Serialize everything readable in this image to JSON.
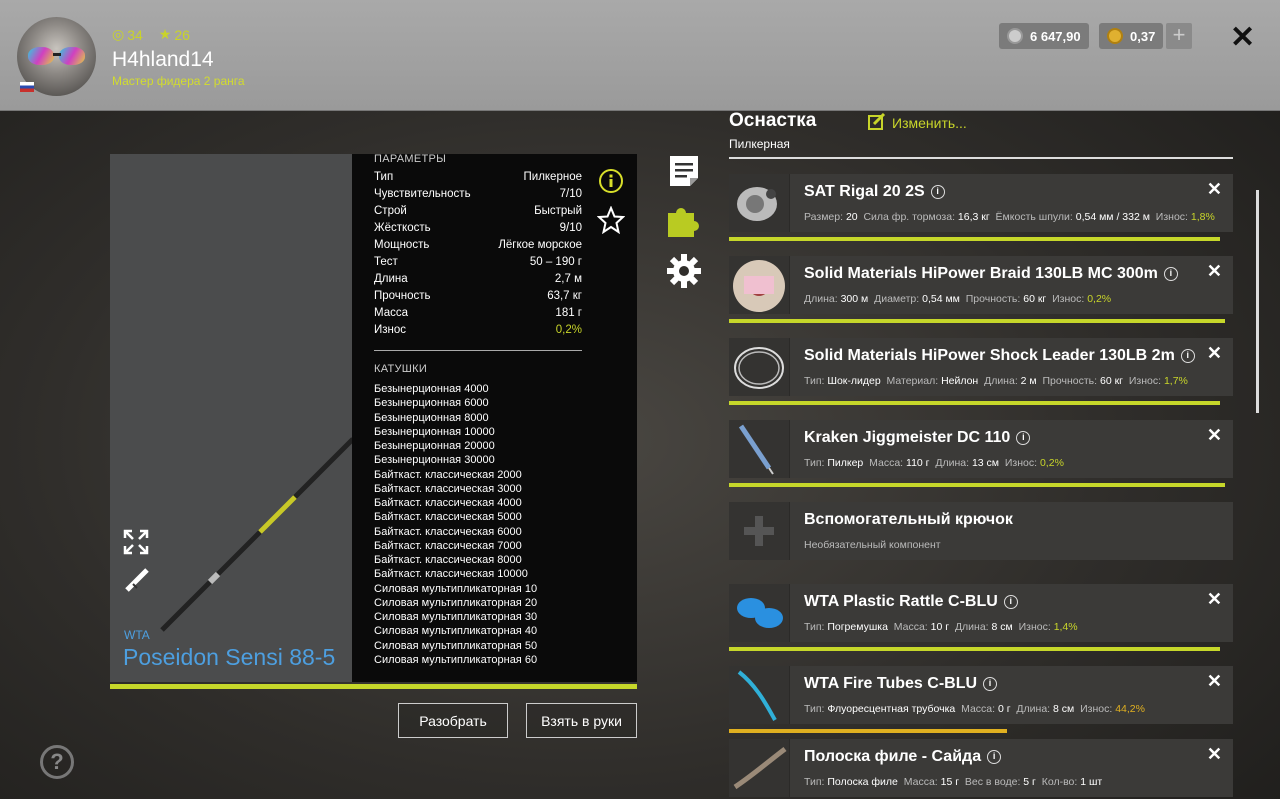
{
  "player": {
    "level": "34",
    "stars": "26",
    "name": "H4hland14",
    "rank": "Мастер фидера 2 ранга"
  },
  "currency": {
    "silver": "6 647,90",
    "gold": "0,37"
  },
  "params": {
    "heading": "ПАРАМЕТРЫ",
    "rows": [
      {
        "k": "Тип",
        "v": "Пилкерное"
      },
      {
        "k": "Чувствительность",
        "v": "7/10"
      },
      {
        "k": "Строй",
        "v": "Быстрый"
      },
      {
        "k": "Жёсткость",
        "v": "9/10"
      },
      {
        "k": "Мощность",
        "v": "Лёгкое морское"
      },
      {
        "k": "Тест",
        "v": "50 – 190 г"
      },
      {
        "k": "Длина",
        "v": "2,7 м"
      },
      {
        "k": "Прочность",
        "v": "63,7 кг"
      },
      {
        "k": "Масса",
        "v": "181 г"
      },
      {
        "k": "Износ",
        "v": "0,2%"
      }
    ]
  },
  "reels": {
    "heading": "КАТУШКИ",
    "items": [
      "Безынерционная 4000",
      "Безынерционная 6000",
      "Безынерционная 8000",
      "Безынерционная 10000",
      "Безынерционная 20000",
      "Безынерционная 30000",
      "Байткаст. классическая 2000",
      "Байткаст. классическая 3000",
      "Байткаст. классическая 4000",
      "Байткаст. классическая 5000",
      "Байткаст. классическая 6000",
      "Байткаст. классическая 7000",
      "Байткаст. классическая 8000",
      "Байткаст. классическая 10000",
      "Силовая мультипликаторная 10",
      "Силовая мультипликаторная 20",
      "Силовая мультипликаторная 30",
      "Силовая мультипликаторная 40",
      "Силовая мультипликаторная 50",
      "Силовая мультипликаторная 60"
    ]
  },
  "rod": {
    "brand": "WTA",
    "name": "Poseidon Sensi 88-5",
    "wear": 0.99
  },
  "buttons": {
    "disassemble": "Разобрать",
    "equip": "Взять в руки"
  },
  "rig": {
    "title": "Оснастка",
    "edit": "Изменить...",
    "subtitle": "Пилкерная"
  },
  "slots": [
    {
      "name": "SAT Rigal 20 2S",
      "info": "i",
      "close": "✕",
      "details": [
        [
          "Размер:",
          "20"
        ],
        [
          "Сила фр. тормоза:",
          "16,3 кг"
        ],
        [
          "Ёмкость шпули:",
          "0,54 мм / 332 м"
        ],
        [
          "Износ:",
          "1,8%"
        ]
      ],
      "wear": 0.99
    },
    {
      "name": "Solid Materials HiPower Braid 130LB MC 300m",
      "info": "i",
      "close": "✕",
      "details": [
        [
          "Длина:",
          "300 м"
        ],
        [
          "Диаметр:",
          "0,54 мм"
        ],
        [
          "Прочность:",
          "60 кг"
        ],
        [
          "Износ:",
          "0,2%"
        ]
      ],
      "wear": 1.0
    },
    {
      "name": "Solid Materials HiPower Shock Leader 130LB 2m",
      "info": "i",
      "close": "✕",
      "details": [
        [
          "Тип:",
          "Шок-лидер"
        ],
        [
          "Материал:",
          "Нейлон"
        ],
        [
          "Длина:",
          "2 м"
        ],
        [
          "Прочность:",
          "60 кг"
        ],
        [
          "Износ:",
          "1,7%"
        ]
      ],
      "wear": 0.99
    },
    {
      "name": "Kraken Jiggmeister DC 110",
      "info": "i",
      "close": "✕",
      "details": [
        [
          "Тип:",
          "Пилкер"
        ],
        [
          "Масса:",
          "110 г"
        ],
        [
          "Длина:",
          "13 см"
        ],
        [
          "Износ:",
          "0,2%"
        ]
      ],
      "wear": 1.0
    },
    {
      "name": "Вспомогательный крючок",
      "info": "",
      "close": "",
      "optional": "Необязательный компонент",
      "details": [],
      "wear": 0
    },
    {
      "name": "WTA Plastic Rattle C-BLU",
      "info": "i",
      "close": "✕",
      "details": [
        [
          "Тип:",
          "Погремушка"
        ],
        [
          "Масса:",
          "10 г"
        ],
        [
          "Длина:",
          "8 см"
        ],
        [
          "Износ:",
          "1,4%"
        ]
      ],
      "wear": 0.99
    },
    {
      "name": "WTA Fire Tubes C-BLU",
      "info": "i",
      "close": "✕",
      "details": [
        [
          "Тип:",
          "Флуоресцентная трубочка"
        ],
        [
          "Масса:",
          "0 г"
        ],
        [
          "Длина:",
          "8 см"
        ],
        [
          "Износ:",
          "44,2%"
        ]
      ],
      "wear": 0.56
    },
    {
      "name": "Полоска филе - Сайда",
      "info": "i",
      "close": "✕",
      "details": [
        [
          "Тип:",
          "Полоска филе"
        ],
        [
          "Масса:",
          "15 г"
        ],
        [
          "Вес в воде:",
          "5 г"
        ],
        [
          "Кол-во:",
          "1 шт"
        ]
      ],
      "wear": 0
    }
  ],
  "colors": {
    "accent": "#c6d72a",
    "warn": "#e0b020",
    "brand_blue": "#4d9fe0"
  },
  "icons": [
    "document-icon",
    "puzzle-icon",
    "gear-icon",
    "info-icon",
    "star-icon",
    "expand-icon",
    "rod-icon",
    "help-icon",
    "edit-icon",
    "close-icon"
  ]
}
